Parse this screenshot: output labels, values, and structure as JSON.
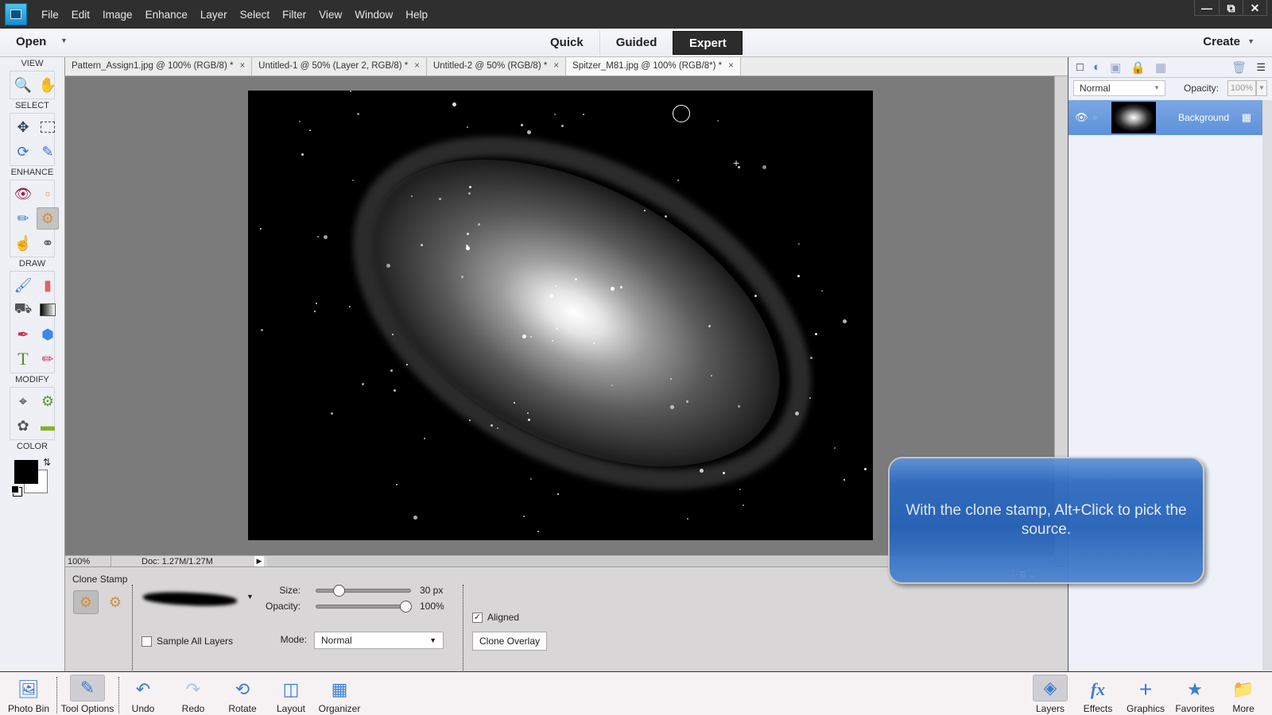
{
  "menubar": {
    "items": [
      "File",
      "Edit",
      "Image",
      "Enhance",
      "Layer",
      "Select",
      "Filter",
      "View",
      "Window",
      "Help"
    ],
    "window_controls": [
      "minimize",
      "restore",
      "close"
    ]
  },
  "modebar": {
    "open_label": "Open",
    "modes": [
      "Quick",
      "Guided",
      "Expert"
    ],
    "active_mode": "Expert",
    "create_label": "Create"
  },
  "toolbox": {
    "sections": {
      "view": "VIEW",
      "select": "SELECT",
      "enhance": "ENHANCE",
      "draw": "DRAW",
      "modify": "MODIFY",
      "color": "COLOR"
    },
    "active_tool": "clone-stamp",
    "foreground_color": "#000000",
    "background_color": "#ffffff"
  },
  "document_tabs": [
    {
      "label": "Pattern_Assign1.jpg @ 100% (RGB/8) *"
    },
    {
      "label": "Untitled-1 @ 50% (Layer 2, RGB/8) *"
    },
    {
      "label": "Untitled-2 @ 50% (RGB/8) *"
    },
    {
      "label": "Spitzer_M81.jpg @ 100% (RGB/8*) *",
      "active": true
    }
  ],
  "status": {
    "zoom": "100%",
    "doc_info": "Doc: 1.27M/1.27M"
  },
  "tool_options": {
    "title": "Clone Stamp",
    "size_label": "Size:",
    "size_value": "30 px",
    "size_fraction": 0.2,
    "opacity_label": "Opacity:",
    "opacity_value": "100%",
    "opacity_fraction": 1.0,
    "mode_label": "Mode:",
    "mode_value": "Normal",
    "sample_all_layers_label": "Sample All Layers",
    "sample_all_layers_checked": false,
    "aligned_label": "Aligned",
    "aligned_checked": true,
    "clone_overlay_label": "Clone Overlay"
  },
  "layers_panel": {
    "blend_mode": "Normal",
    "opacity_label": "Opacity:",
    "opacity_value": "100%",
    "layers": [
      {
        "name": "Background",
        "visible": true,
        "selected": true
      }
    ]
  },
  "tooltip": {
    "text": "With the clone stamp, Alt+Click to pick the source."
  },
  "taskbar": {
    "left": [
      {
        "label": "Photo Bin",
        "icon": "photo-bin-icon"
      },
      {
        "label": "Tool Options",
        "icon": "tool-options-icon",
        "active": true
      },
      {
        "label": "Undo",
        "icon": "undo-icon"
      },
      {
        "label": "Redo",
        "icon": "redo-icon"
      },
      {
        "label": "Rotate",
        "icon": "rotate-icon"
      },
      {
        "label": "Layout",
        "icon": "layout-icon"
      },
      {
        "label": "Organizer",
        "icon": "organizer-icon"
      }
    ],
    "right": [
      {
        "label": "Layers",
        "icon": "layers-icon",
        "active": true
      },
      {
        "label": "Effects",
        "icon": "effects-icon"
      },
      {
        "label": "Graphics",
        "icon": "graphics-icon"
      },
      {
        "label": "Favorites",
        "icon": "favorites-icon"
      },
      {
        "label": "More",
        "icon": "more-icon"
      }
    ]
  }
}
